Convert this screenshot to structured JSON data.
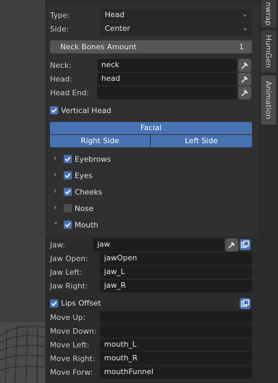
{
  "colors": {
    "accent": "#4772b3",
    "panel": "#303030",
    "field": "#1d1d1d"
  },
  "type_row": {
    "label": "Type:",
    "value": "Head"
  },
  "side_row": {
    "label": "Side:",
    "value": "Center"
  },
  "neck_bones": {
    "label": "Neck Bones Amount",
    "value": "1"
  },
  "bones": [
    {
      "label": "Neck:",
      "value": "neck"
    },
    {
      "label": "Head:",
      "value": "head"
    },
    {
      "label": "Head End:",
      "value": ""
    }
  ],
  "vertical_head": {
    "label": "Vertical Head",
    "checked": true
  },
  "facial": {
    "header": "Facial",
    "left_tab": "Right Side",
    "right_tab": "Left Side"
  },
  "features": [
    {
      "label": "Eyebrows",
      "checked": true,
      "expanded": false
    },
    {
      "label": "Eyes",
      "checked": true,
      "expanded": false
    },
    {
      "label": "Cheeks",
      "checked": true,
      "expanded": false
    },
    {
      "label": "Nose",
      "checked": false,
      "expanded": false
    },
    {
      "label": "Mouth",
      "checked": true,
      "expanded": true
    }
  ],
  "jaw": {
    "label": "Jaw:",
    "value": "jaw"
  },
  "jaw_fields": [
    {
      "label": "Jaw Open:",
      "value": "jawOpen"
    },
    {
      "label": "Jaw Left:",
      "value": "jaw_L"
    },
    {
      "label": "Jaw Right:",
      "value": "jaw_R"
    }
  ],
  "lips_offset": {
    "label": "Lips Offset",
    "checked": true
  },
  "move_fields": [
    {
      "label": "Move Up:",
      "value": ""
    },
    {
      "label": "Move Down:",
      "value": ""
    },
    {
      "label": "Move Left:",
      "value": "mouth_L"
    },
    {
      "label": "Move Right:",
      "value": "mouth_R"
    },
    {
      "label": "Move Forw:",
      "value": "mouthFunnel"
    }
  ],
  "tabs": [
    "nwrap",
    "HumGen",
    "Animation"
  ],
  "icons": {
    "eyedropper": "eyedropper-icon",
    "copy": "copy-icon",
    "expand": "chevron-right-icon",
    "collapse": "chevron-down-icon",
    "check": "check-icon",
    "dropdown": "chevron-down-icon"
  }
}
